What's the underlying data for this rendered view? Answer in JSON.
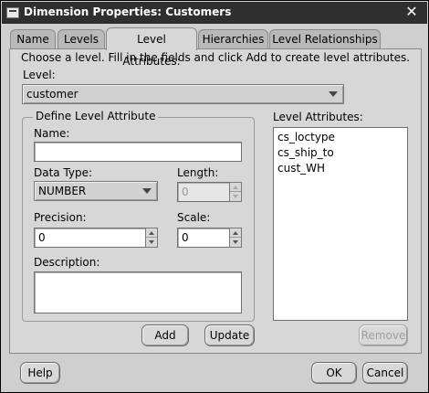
{
  "window": {
    "title": "Dimension Properties: Customers"
  },
  "tabs": [
    {
      "label": "Name"
    },
    {
      "label": "Levels"
    },
    {
      "label": "Level Attributes:"
    },
    {
      "label": "Hierarchies"
    },
    {
      "label": "Level Relationships"
    }
  ],
  "instructions": "Choose a level.  Fill in the fields and click Add to create level attributes.",
  "level": {
    "label": "Level:",
    "selected": "customer"
  },
  "define_group": {
    "title": "Define Level Attribute",
    "name_label": "Name:",
    "name_value": "",
    "data_type_label": "Data Type:",
    "data_type_value": "NUMBER",
    "length_label": "Length:",
    "length_value": "0",
    "precision_label": "Precision:",
    "precision_value": "0",
    "scale_label": "Scale:",
    "scale_value": "0",
    "description_label": "Description:",
    "description_value": ""
  },
  "level_attributes": {
    "label": "Level Attributes:",
    "items": [
      "cs_loctype",
      "cs_ship_to",
      "cust_WH"
    ]
  },
  "buttons": {
    "add": "Add",
    "update": "Update",
    "remove": "Remove",
    "help": "Help",
    "ok": "OK",
    "cancel": "Cancel"
  }
}
